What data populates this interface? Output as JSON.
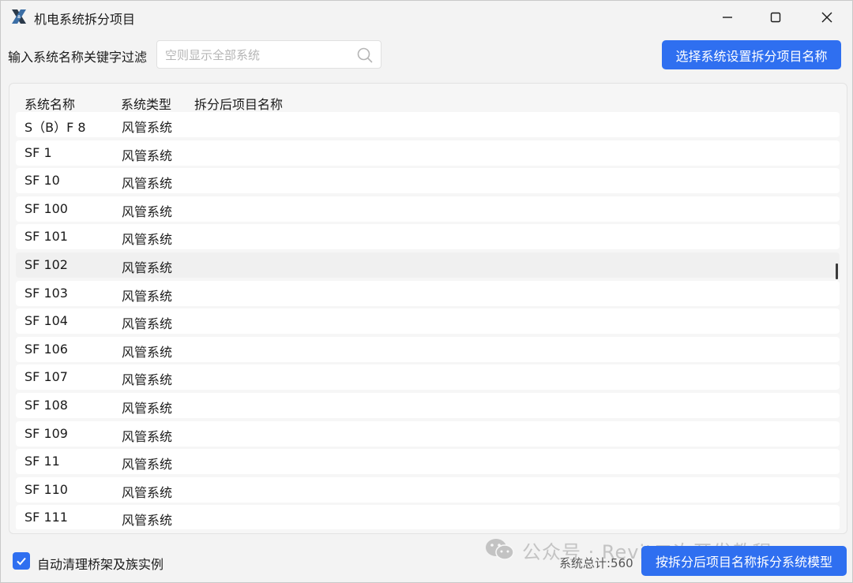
{
  "window": {
    "title": "机电系统拆分项目"
  },
  "toolbar": {
    "filter_label": "输入系统名称关键字过滤",
    "search_placeholder": "空则显示全部系统",
    "search_value": "",
    "set_name_button": "选择系统设置拆分项目名称"
  },
  "table": {
    "headers": [
      "系统名称",
      "系统类型",
      "拆分后项目名称"
    ],
    "rows": [
      {
        "name": "S（B）F 8",
        "type": "风管系统",
        "project": ""
      },
      {
        "name": "SF 1",
        "type": "风管系统",
        "project": ""
      },
      {
        "name": "SF 10",
        "type": "风管系统",
        "project": ""
      },
      {
        "name": "SF 100",
        "type": "风管系统",
        "project": ""
      },
      {
        "name": "SF 101",
        "type": "风管系统",
        "project": ""
      },
      {
        "name": "SF 102",
        "type": "风管系统",
        "project": ""
      },
      {
        "name": "SF 103",
        "type": "风管系统",
        "project": ""
      },
      {
        "name": "SF 104",
        "type": "风管系统",
        "project": ""
      },
      {
        "name": "SF 106",
        "type": "风管系统",
        "project": ""
      },
      {
        "name": "SF 107",
        "type": "风管系统",
        "project": ""
      },
      {
        "name": "SF 108",
        "type": "风管系统",
        "project": ""
      },
      {
        "name": "SF 109",
        "type": "风管系统",
        "project": ""
      },
      {
        "name": "SF 11",
        "type": "风管系统",
        "project": ""
      },
      {
        "name": "SF 110",
        "type": "风管系统",
        "project": ""
      },
      {
        "name": "SF 111",
        "type": "风管系统",
        "project": ""
      }
    ]
  },
  "footer": {
    "auto_clean_label": "自动清理桥架及族实例",
    "auto_clean_checked": true,
    "total_text": "系统总计:560",
    "split_button": "按拆分后项目名称拆分系统模型"
  },
  "watermark": {
    "text": "公众号 · Revit二次开发教程"
  },
  "icons": {
    "app": "revit-x-icon",
    "search": "search-icon",
    "minimize": "minimize-icon",
    "maximize": "maximize-icon",
    "close": "close-icon",
    "check": "check-icon",
    "wechat": "wechat-icon"
  },
  "colors": {
    "accent": "#2f6ff0",
    "window_bg": "#f3f3f3",
    "row_bg": "#ffffff"
  }
}
